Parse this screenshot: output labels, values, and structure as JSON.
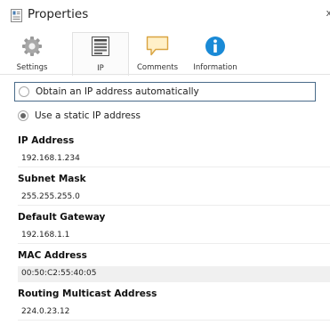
{
  "window": {
    "title": "Properties",
    "close_glyph": "x"
  },
  "tabs": [
    {
      "label": "Settings",
      "icon": "gear-icon",
      "active": false
    },
    {
      "label": "IP",
      "icon": "ip-list-icon",
      "active": true
    },
    {
      "label": "Comments",
      "icon": "comment-icon",
      "active": false
    },
    {
      "label": "Information",
      "icon": "info-icon",
      "active": false
    }
  ],
  "ip_mode": {
    "auto_label": "Obtain an IP address automatically",
    "static_label": "Use a static IP address",
    "selected": "static"
  },
  "fields": {
    "ip_address": {
      "label": "IP Address",
      "value": "192.168.1.234",
      "editable": true
    },
    "subnet_mask": {
      "label": "Subnet Mask",
      "value": "255.255.255.0",
      "editable": true
    },
    "default_gateway": {
      "label": "Default Gateway",
      "value": "192.168.1.1",
      "editable": true
    },
    "mac_address": {
      "label": "MAC Address",
      "value": "00:50:C2:55:40:05",
      "editable": false
    },
    "routing_multicast": {
      "label": "Routing Multicast Address",
      "value": "224.0.23.12",
      "editable": true
    }
  },
  "colors": {
    "accent": "#1a8ad6",
    "comment_fill": "#fff0c8",
    "comment_stroke": "#d9a441",
    "focus_border": "#4a6b8a"
  }
}
